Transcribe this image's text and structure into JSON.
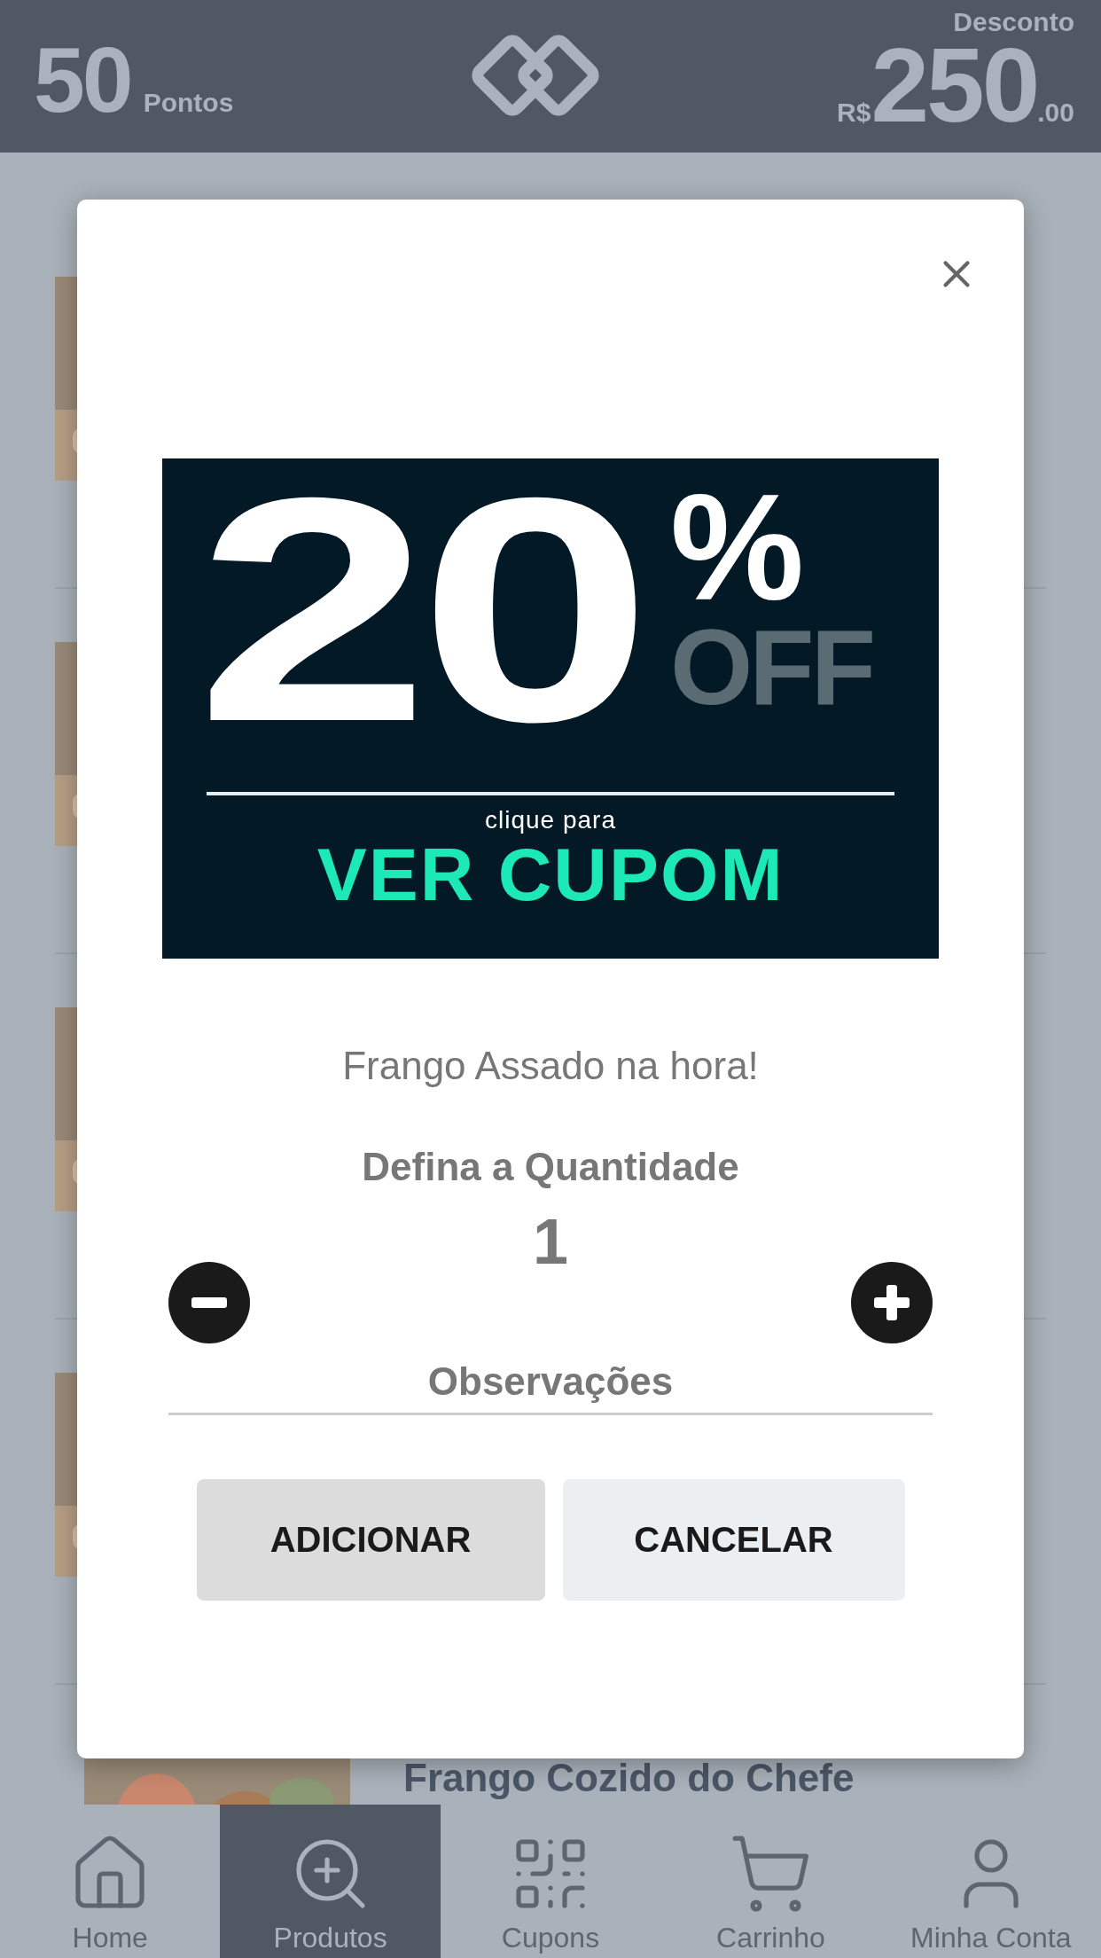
{
  "header": {
    "points": "50",
    "points_label": "Pontos",
    "discount_label": "Desconto",
    "currency": "R$",
    "discount_value": "250",
    "discount_cents": ".00"
  },
  "products": [
    {
      "kind": "picture"
    },
    {
      "kind": "picture"
    },
    {
      "kind": "picture"
    },
    {
      "kind": "picture"
    },
    {
      "kind": "picture",
      "name": "Frango Cozido do Chefe"
    }
  ],
  "modal": {
    "banner": {
      "big": "20",
      "percent": "%",
      "off": "OFF",
      "caption": "clique para",
      "cta": "VER CUPOM"
    },
    "product_name": "Frango Assado na hora!",
    "quantity_label": "Defina a Quantidade",
    "quantity": "1",
    "observations_placeholder": "Observações",
    "buttons": [
      {
        "label": "ADICIONAR",
        "kind": "primary"
      },
      {
        "label": "CANCELAR",
        "kind": "secondary"
      }
    ]
  },
  "nav": [
    {
      "label": "Home",
      "selected": false
    },
    {
      "label": "Produtos",
      "selected": true
    },
    {
      "label": "Cupons",
      "selected": false
    },
    {
      "label": "Carrinho",
      "selected": false
    },
    {
      "label": "Minha Conta",
      "selected": false
    }
  ]
}
